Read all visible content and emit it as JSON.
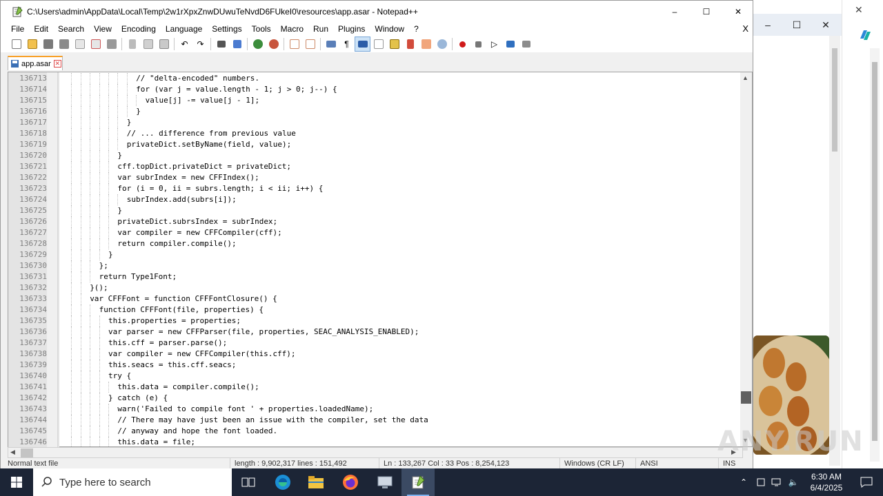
{
  "window": {
    "title": "C:\\Users\\admin\\AppData\\Local\\Temp\\2w1rXpxZnwDUwuTeNvdD6FUkeI0\\resources\\app.asar - Notepad++",
    "minimize": "–",
    "maximize": "☐",
    "close": "✕"
  },
  "menu": {
    "items": [
      "File",
      "Edit",
      "Search",
      "View",
      "Encoding",
      "Language",
      "Settings",
      "Tools",
      "Macro",
      "Run",
      "Plugins",
      "Window",
      "?"
    ],
    "close": "X"
  },
  "tab": {
    "label": "app.asar",
    "close": "✕"
  },
  "editor": {
    "lines": [
      {
        "n": "136713",
        "i": 16,
        "t": "// \"delta-encoded\" numbers."
      },
      {
        "n": "136714",
        "i": 16,
        "t": "for (var j = value.length - 1; j > 0; j--) {"
      },
      {
        "n": "136715",
        "i": 18,
        "t": "value[j] -= value[j - 1];"
      },
      {
        "n": "136716",
        "i": 16,
        "t": "}"
      },
      {
        "n": "136717",
        "i": 14,
        "t": "}"
      },
      {
        "n": "136718",
        "i": 14,
        "t": "// ... difference from previous value"
      },
      {
        "n": "136719",
        "i": 14,
        "t": "privateDict.setByName(field, value);"
      },
      {
        "n": "136720",
        "i": 12,
        "t": "}"
      },
      {
        "n": "136721",
        "i": 12,
        "t": "cff.topDict.privateDict = privateDict;"
      },
      {
        "n": "136722",
        "i": 12,
        "t": "var subrIndex = new CFFIndex();"
      },
      {
        "n": "136723",
        "i": 12,
        "t": "for (i = 0, ii = subrs.length; i < ii; i++) {"
      },
      {
        "n": "136724",
        "i": 14,
        "t": "subrIndex.add(subrs[i]);"
      },
      {
        "n": "136725",
        "i": 12,
        "t": "}"
      },
      {
        "n": "136726",
        "i": 12,
        "t": "privateDict.subrsIndex = subrIndex;"
      },
      {
        "n": "136727",
        "i": 12,
        "t": "var compiler = new CFFCompiler(cff);"
      },
      {
        "n": "136728",
        "i": 12,
        "t": "return compiler.compile();"
      },
      {
        "n": "136729",
        "i": 10,
        "t": "}"
      },
      {
        "n": "136730",
        "i": 8,
        "t": "};"
      },
      {
        "n": "136731",
        "i": 8,
        "t": "return Type1Font;"
      },
      {
        "n": "136732",
        "i": 6,
        "t": "}();"
      },
      {
        "n": "136733",
        "i": 6,
        "t": "var CFFFont = function CFFFontClosure() {"
      },
      {
        "n": "136734",
        "i": 8,
        "t": "function CFFFont(file, properties) {"
      },
      {
        "n": "136735",
        "i": 10,
        "t": "this.properties = properties;"
      },
      {
        "n": "136736",
        "i": 10,
        "t": "var parser = new CFFParser(file, properties, SEAC_ANALYSIS_ENABLED);"
      },
      {
        "n": "136737",
        "i": 10,
        "t": "this.cff = parser.parse();"
      },
      {
        "n": "136738",
        "i": 10,
        "t": "var compiler = new CFFCompiler(this.cff);"
      },
      {
        "n": "136739",
        "i": 10,
        "t": "this.seacs = this.cff.seacs;"
      },
      {
        "n": "136740",
        "i": 10,
        "t": "try {"
      },
      {
        "n": "136741",
        "i": 12,
        "t": "this.data = compiler.compile();"
      },
      {
        "n": "136742",
        "i": 10,
        "t": "} catch (e) {"
      },
      {
        "n": "136743",
        "i": 12,
        "t": "warn('Failed to compile font ' + properties.loadedName);"
      },
      {
        "n": "136744",
        "i": 12,
        "t": "// There may have just been an issue with the compiler, set the data"
      },
      {
        "n": "136745",
        "i": 12,
        "t": "// anyway and hope the font loaded."
      },
      {
        "n": "136746",
        "i": 12,
        "t": "this.data = file;"
      }
    ]
  },
  "status": {
    "type": "Normal text file",
    "length": "length : 9,902,317    lines : 151,492",
    "position": "Ln : 133,267    Col : 33    Pos : 8,254,123",
    "eol": "Windows (CR LF)",
    "encoding": "ANSI",
    "mode": "INS"
  },
  "taskbar": {
    "search_placeholder": "Type here to search",
    "time": "6:30 AM",
    "date": "6/4/2025"
  },
  "watermark": "ANY.RUN",
  "colors": {
    "accent_tab": "#f8a028",
    "taskbar": "#1c2536"
  }
}
